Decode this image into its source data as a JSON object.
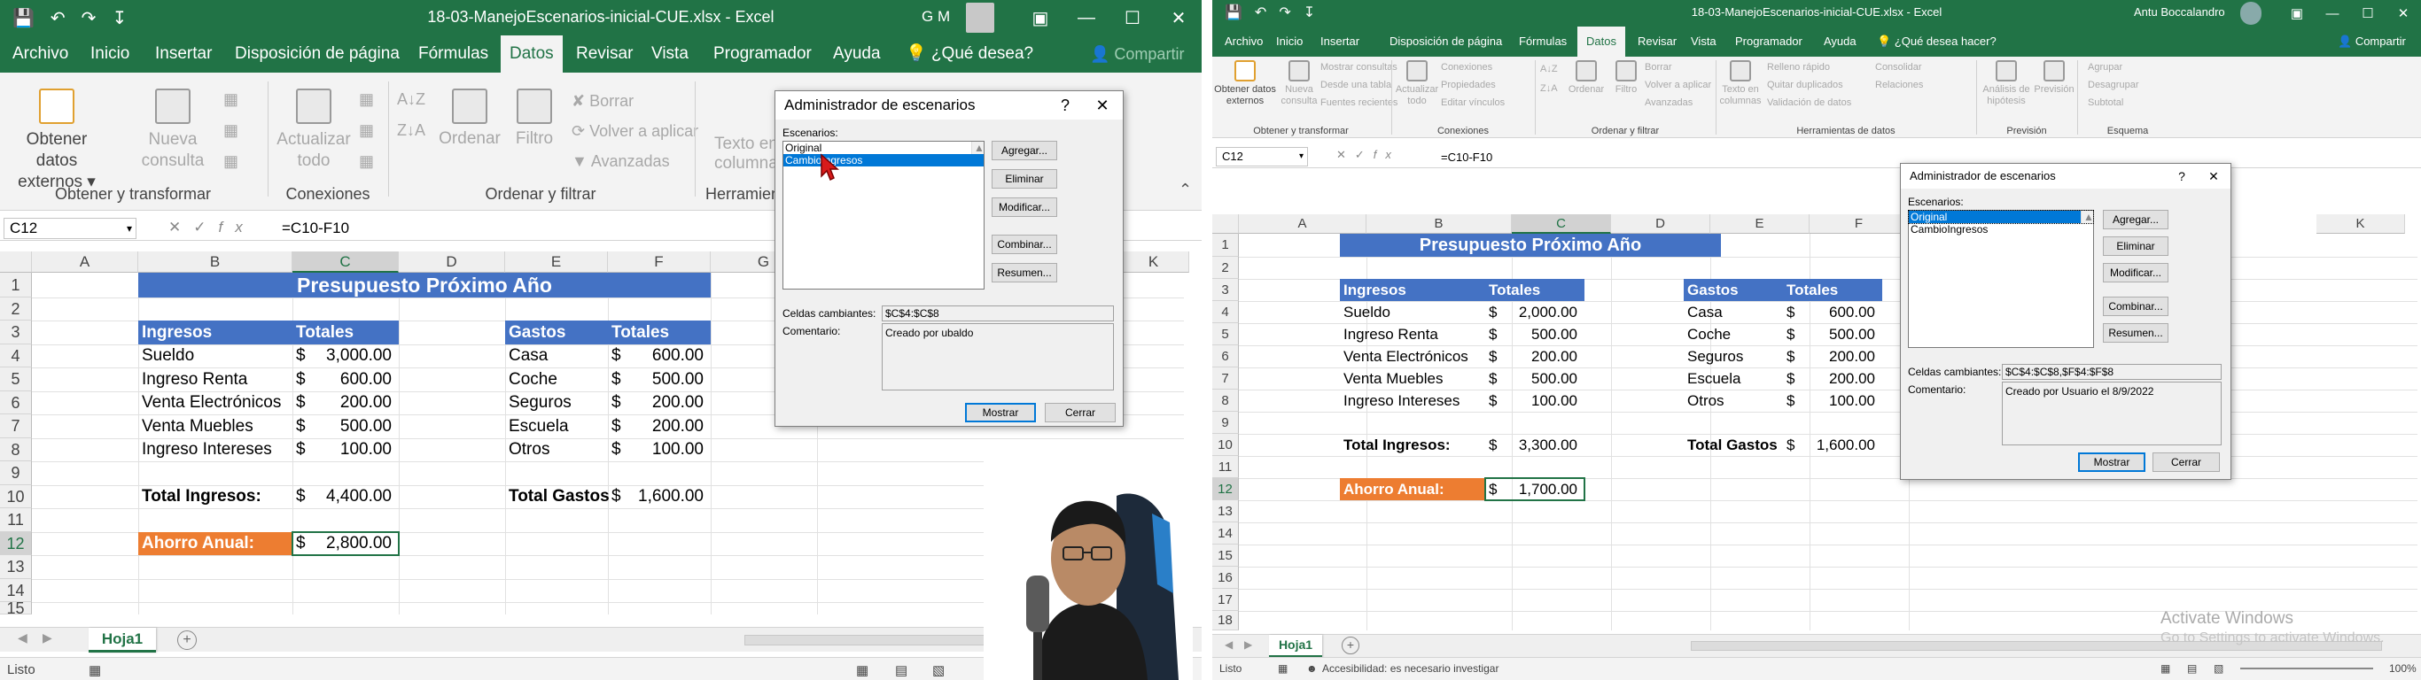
{
  "left": {
    "window_title": "18-03-ManejoEscenarios-inicial-CUE.xlsx  -  Excel",
    "user_initials": "G M",
    "tabs": [
      "Archivo",
      "Inicio",
      "Insertar",
      "Disposición de página",
      "Fórmulas",
      "Datos",
      "Revisar",
      "Vista",
      "Programador",
      "Ayuda"
    ],
    "active_tab": "Datos",
    "tell_me": "¿Qué desea?",
    "share": "Compartir",
    "ribbon": {
      "g1_btn": "Obtener datos externos",
      "g1_btn2": "Nueva consulta",
      "g1_label": "Obtener y transformar",
      "g2_btn": "Actualizar todo",
      "g2_label": "Conexiones",
      "sort": "Ordenar",
      "filter": "Filtro",
      "clear": "Borrar",
      "reapply": "Volver a aplicar",
      "advanced": "Avanzadas",
      "g3_label": "Ordenar y filtrar",
      "text_to_cols": "Texto en columnas",
      "g4_label": "Herramien"
    },
    "name_box": "C12",
    "formula": "=C10-F10",
    "columns": [
      "A",
      "B",
      "C",
      "D",
      "E",
      "F",
      "G",
      "K"
    ],
    "rows": [
      "1",
      "2",
      "3",
      "4",
      "5",
      "6",
      "7",
      "8",
      "9",
      "10",
      "11",
      "12",
      "13",
      "14",
      "15"
    ],
    "sheet_tab": "Hoja1",
    "status": "Listo",
    "dialog": {
      "title": "Administrador de escenarios",
      "help": "?",
      "close": "✕",
      "scenarios_label": "Escenarios:",
      "scenarios": [
        "Original",
        "CambioIngresos"
      ],
      "btn_add": "Agregar...",
      "btn_delete": "Eliminar",
      "btn_edit": "Modificar...",
      "btn_merge": "Combinar...",
      "btn_summary": "Resumen...",
      "changing_label": "Celdas cambiantes:",
      "changing_value": "$C$4:$C$8",
      "comment_label": "Comentario:",
      "comment_value": "Creado por ubaldo",
      "btn_show": "Mostrar",
      "btn_close": "Cerrar"
    }
  },
  "right": {
    "window_title": "18-03-ManejoEscenarios-inicial-CUE.xlsx  -  Excel",
    "user_name": "Antu Boccalandro",
    "tabs": [
      "Archivo",
      "Inicio",
      "Insertar",
      "Disposición de página",
      "Fórmulas",
      "Datos",
      "Revisar",
      "Vista",
      "Programador",
      "Ayuda"
    ],
    "active_tab": "Datos",
    "tell_me": "¿Qué desea hacer?",
    "share": "Compartir",
    "ribbon": {
      "get_data": "Obtener datos externos",
      "new_query": "Nueva consulta",
      "show_queries": "Mostrar consultas",
      "from_table": "Desde una tabla",
      "recent_sources": "Fuentes recientes",
      "g1_label": "Obtener y transformar",
      "refresh_all": "Actualizar todo",
      "connections": "Conexiones",
      "properties": "Propiedades",
      "edit_links": "Editar vínculos",
      "g2_label": "Conexiones",
      "sort": "Ordenar",
      "filter": "Filtro",
      "clear": "Borrar",
      "reapply": "Volver a aplicar",
      "advanced": "Avanzadas",
      "g3_label": "Ordenar y filtrar",
      "text_to_cols": "Texto en columnas",
      "flash_fill": "Relleno rápido",
      "remove_dups": "Quitar duplicados",
      "validation": "Validación de datos",
      "consolidate": "Consolidar",
      "relations": "Relaciones",
      "g4_label": "Herramientas de datos",
      "whatif": "Análisis de hipótesis",
      "forecast": "Previsión",
      "g5_label": "Previsión",
      "group": "Agrupar",
      "ungroup": "Desagrupar",
      "subtotal": "Subtotal",
      "g6_label": "Esquema"
    },
    "name_box": "C12",
    "formula": "=C10-F10",
    "columns": [
      "A",
      "B",
      "C",
      "D",
      "E",
      "F",
      "K"
    ],
    "rows": [
      "1",
      "2",
      "3",
      "4",
      "5",
      "6",
      "7",
      "8",
      "9",
      "10",
      "11",
      "12",
      "13",
      "14",
      "15",
      "16",
      "17",
      "18"
    ],
    "sheet_tab": "Hoja1",
    "status": "Listo",
    "accessibility": "Accesibilidad: es necesario investigar",
    "zoom": "100%",
    "activate_title": "Activate Windows",
    "activate_sub": "Go to Settings to activate Windows.",
    "dialog": {
      "title": "Administrador de escenarios",
      "help": "?",
      "close": "✕",
      "scenarios_label": "Escenarios:",
      "scenarios": [
        "Original",
        "CambioIngresos"
      ],
      "btn_add": "Agregar...",
      "btn_delete": "Eliminar",
      "btn_edit": "Modificar...",
      "btn_merge": "Combinar...",
      "btn_summary": "Resumen...",
      "changing_label": "Celdas cambiantes:",
      "changing_value": "$C$4:$C$8,$F$4:$F$8",
      "comment_label": "Comentario:",
      "comment_value": "Creado por Usuario el 8/9/2022",
      "btn_show": "Mostrar",
      "btn_close": "Cerrar"
    }
  },
  "sheet_left": {
    "title": "Presupuesto Próximo Año",
    "income_header": "Ingresos",
    "totals_header": "Totales",
    "expenses_header": "Gastos",
    "currency": "$",
    "income": [
      {
        "label": "Sueldo",
        "value": "3,000.00"
      },
      {
        "label": "Ingreso Renta",
        "value": "600.00"
      },
      {
        "label": "Venta Electrónicos",
        "value": "200.00"
      },
      {
        "label": "Venta Muebles",
        "value": "500.00"
      },
      {
        "label": "Ingreso Intereses",
        "value": "100.00"
      }
    ],
    "expenses": [
      {
        "label": "Casa",
        "value": "600.00"
      },
      {
        "label": "Coche",
        "value": "500.00"
      },
      {
        "label": "Seguros",
        "value": "200.00"
      },
      {
        "label": "Escuela",
        "value": "200.00"
      },
      {
        "label": "Otros",
        "value": "100.00"
      }
    ],
    "total_income_label": "Total Ingresos:",
    "total_income": "4,400.00",
    "total_expenses_label": "Total Gastos",
    "total_expenses": "1,600.00",
    "savings_label": "Ahorro Anual:",
    "savings": "2,800.00"
  },
  "sheet_right": {
    "title": "Presupuesto Próximo Año",
    "income_header": "Ingresos",
    "totals_header": "Totales",
    "expenses_header": "Gastos",
    "currency": "$",
    "income": [
      {
        "label": "Sueldo",
        "value": "2,000.00"
      },
      {
        "label": "Ingreso Renta",
        "value": "500.00"
      },
      {
        "label": "Venta Electrónicos",
        "value": "200.00"
      },
      {
        "label": "Venta Muebles",
        "value": "500.00"
      },
      {
        "label": "Ingreso Intereses",
        "value": "100.00"
      }
    ],
    "expenses": [
      {
        "label": "Casa",
        "value": "600.00"
      },
      {
        "label": "Coche",
        "value": "500.00"
      },
      {
        "label": "Seguros",
        "value": "200.00"
      },
      {
        "label": "Escuela",
        "value": "200.00"
      },
      {
        "label": "Otros",
        "value": "100.00"
      }
    ],
    "total_income_label": "Total Ingresos:",
    "total_income": "3,300.00",
    "total_expenses_label": "Total Gastos",
    "total_expenses": "1,600.00",
    "savings_label": "Ahorro Anual:",
    "savings": "1,700.00"
  },
  "colors": {
    "excel_green": "#217346",
    "table_blue": "#4472c4",
    "orange": "#ed7d31",
    "selection": "#0078d7"
  }
}
